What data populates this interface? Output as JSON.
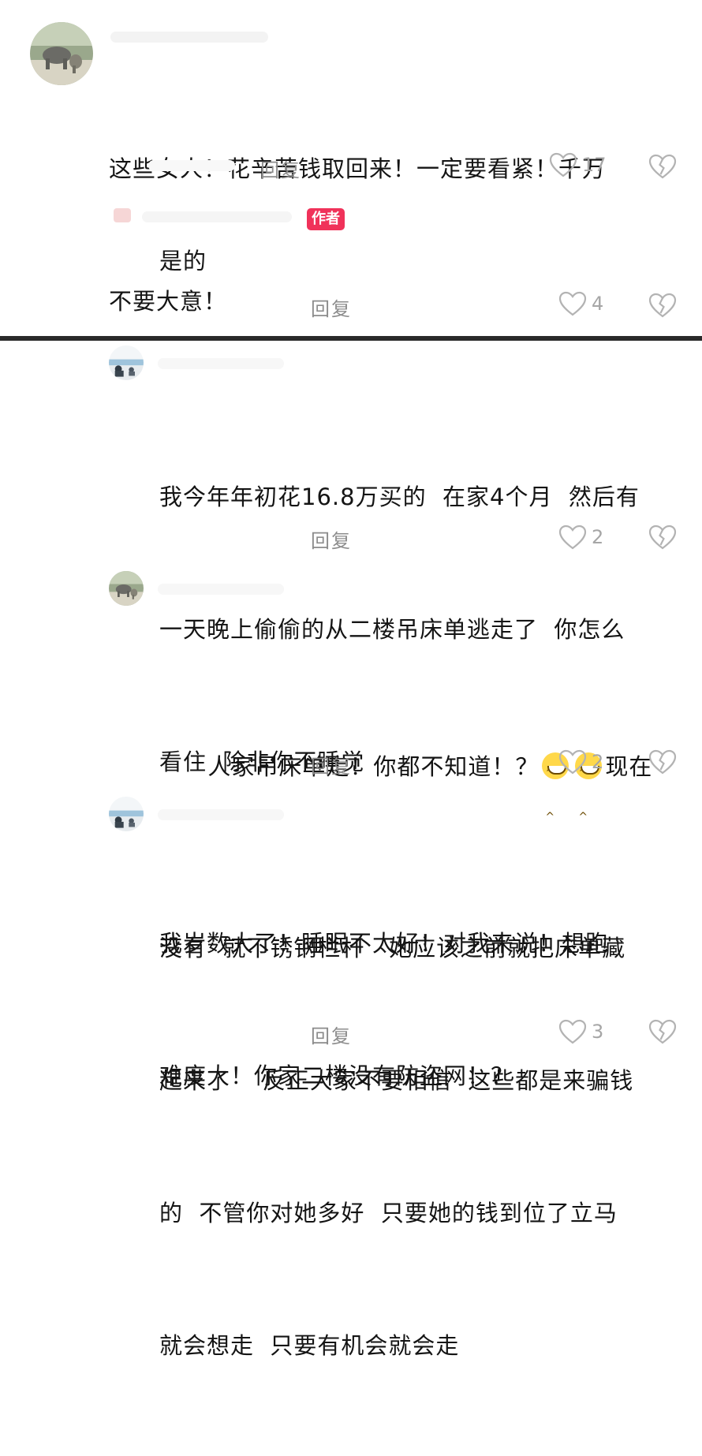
{
  "comments": [
    {
      "text_line1": "这些女人！花辛苦钱取回来！一定要看紧！千万",
      "text_line2": "不要大意！",
      "reply_label": "回复",
      "likes": "17"
    },
    {
      "badge": "作者",
      "text": "是的",
      "reply_label": "回复",
      "likes": "4"
    },
    {
      "text_line1": "我今年年初花16.8万买的  在家4个月  然后有",
      "text_line2": "一天晚上偷偷的从二楼吊床单逃走了  你怎么",
      "text_line3": "看住  除非你不睡觉",
      "reply_label": "回复",
      "likes": "2"
    },
    {
      "text_line1_a": "人家吊床单走！你都不知道！？",
      "text_line1_b": "现在",
      "text_line2": "我岁数大了！睡眠不太好！对我来说！想跑",
      "text_line3": "难度大！你家二楼没有防盗网！？",
      "reply_label": "回复",
      "likes": "2"
    },
    {
      "text_line1": "没有  就不锈钢栏杆   她应该之前就把床单藏",
      "text_line2": "起来了    反正大家不要相信  这些都是来骗钱",
      "text_line3": "的  不管你对她多好  只要她的钱到位了立马",
      "text_line4": "就会想走  只要有机会就会走",
      "reply_label": "回复",
      "likes": "3"
    }
  ],
  "icons": {
    "like": "heart-outline-icon",
    "dislike": "broken-heart-icon",
    "emoji": "grinning-emoji-icon"
  },
  "colors": {
    "badge": "#f0325a",
    "meta_text": "#8c8c8c",
    "divider": "#2a2a2a"
  }
}
